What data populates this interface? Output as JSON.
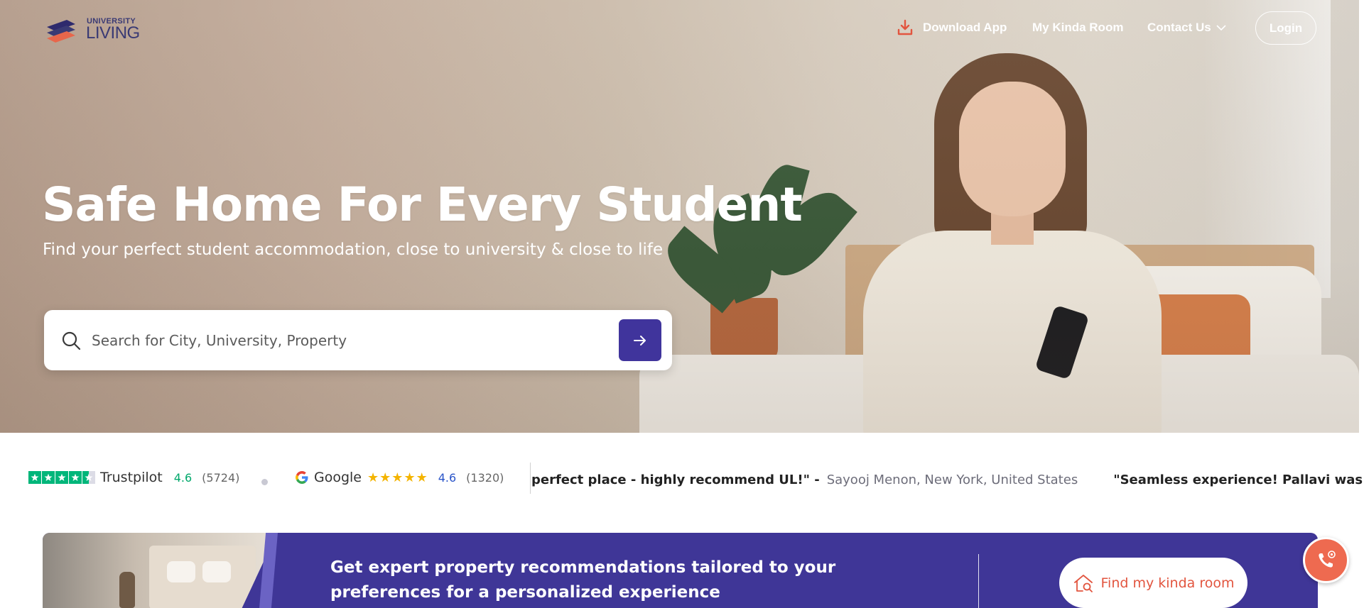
{
  "brand": {
    "logo_text_top": "UNIVERSITY",
    "logo_text_main": "LIVING",
    "logo_mark": "®"
  },
  "nav": {
    "download_app": "Download App",
    "my_kinda_room": "My Kinda Room",
    "contact_us": "Contact Us",
    "login": "Login"
  },
  "hero": {
    "title": "Safe Home For Every Student",
    "subtitle": "Find your perfect student accommodation, close to university & close to life"
  },
  "search": {
    "placeholder": "Search for City, University, Property"
  },
  "reviews": {
    "trustpilot": {
      "name": "Trustpilot",
      "rating": "4.6",
      "count": "(5724)"
    },
    "google": {
      "name": "Google",
      "rating": "4.6",
      "count": "(1320)"
    },
    "testimonials": [
      {
        "quote": "perfect place - highly recommend UL!\" -",
        "author": "Sayooj Menon, New York, United States"
      },
      {
        "quote": "\"Seamless experience! Pallavi was super"
      }
    ]
  },
  "promo": {
    "text": "Get expert property recommendations tailored to your preferences for a personalized experience",
    "button": "Find my kinda room"
  },
  "colors": {
    "primary": "#40349c",
    "accent": "#e2553f",
    "trustpilot_green": "#00b67a",
    "google_star": "#f4b400"
  },
  "icons": {
    "download": "download-icon",
    "chevron": "chevron-down-icon",
    "search": "search-icon",
    "arrow": "arrow-right-icon",
    "house": "house-search-icon",
    "call": "phone-call-icon"
  }
}
